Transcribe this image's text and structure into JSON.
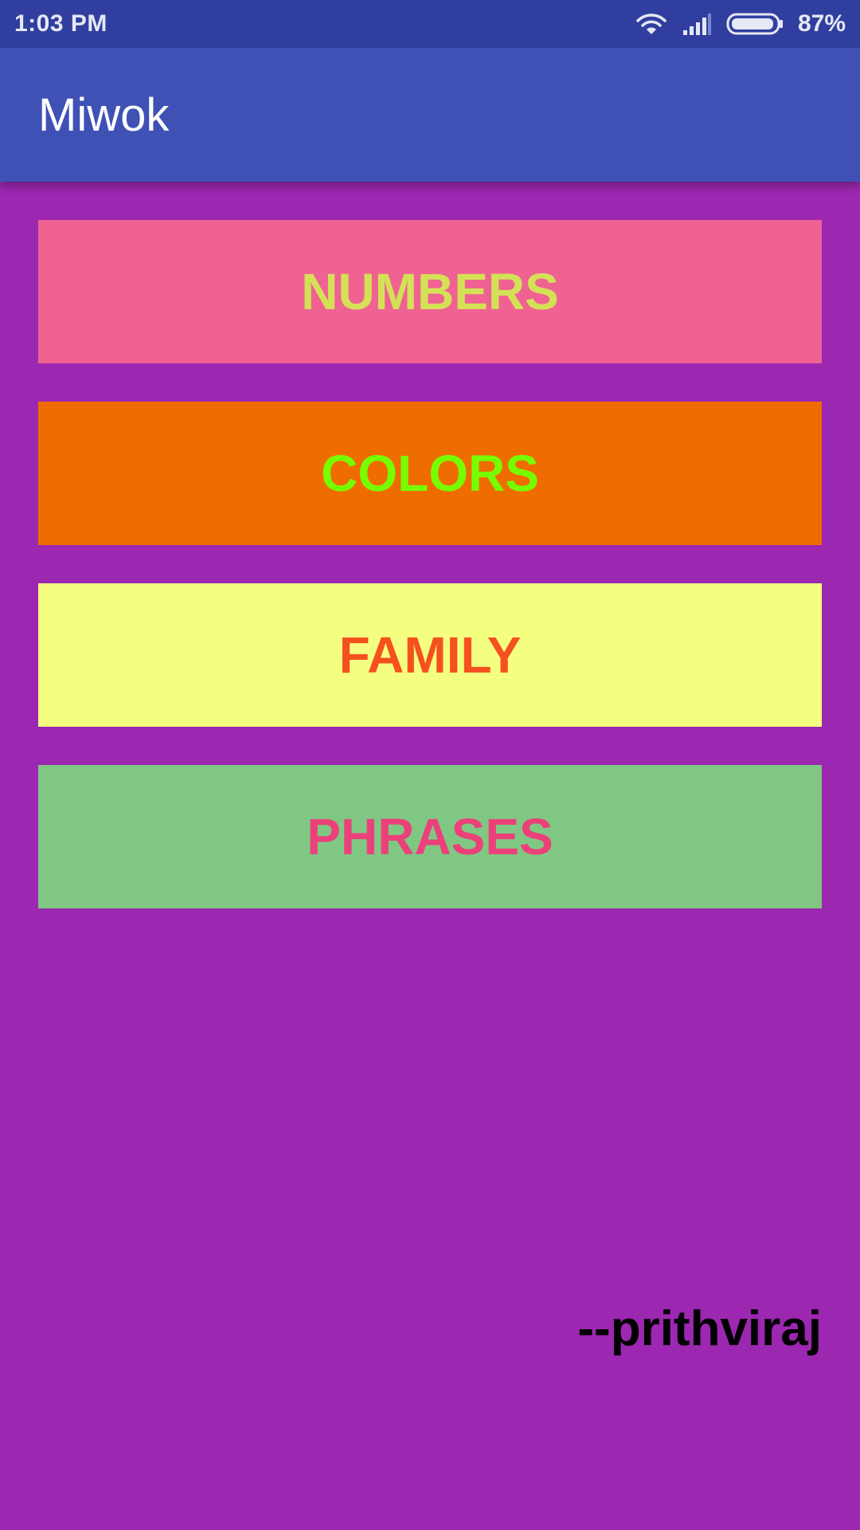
{
  "status_bar": {
    "time": "1:03 PM",
    "battery_percent": "87%",
    "icons": [
      "wifi-icon",
      "signal-icon",
      "battery-icon"
    ]
  },
  "app_bar": {
    "title": "Miwok"
  },
  "categories": [
    {
      "label": "NUMBERS",
      "background": "#f06292",
      "text_color": "#d4e157"
    },
    {
      "label": "COLORS",
      "background": "#ef6c00",
      "text_color": "#76ff03"
    },
    {
      "label": "FAMILY",
      "background": "#f4ff81",
      "text_color": "#f4511e"
    },
    {
      "label": "PHRASES",
      "background": "#81c784",
      "text_color": "#ec407a"
    }
  ],
  "signature": "--prithviraj",
  "colors": {
    "status_bar": "#303f9f",
    "app_bar": "#3f51b5",
    "background": "#9c27b0"
  }
}
